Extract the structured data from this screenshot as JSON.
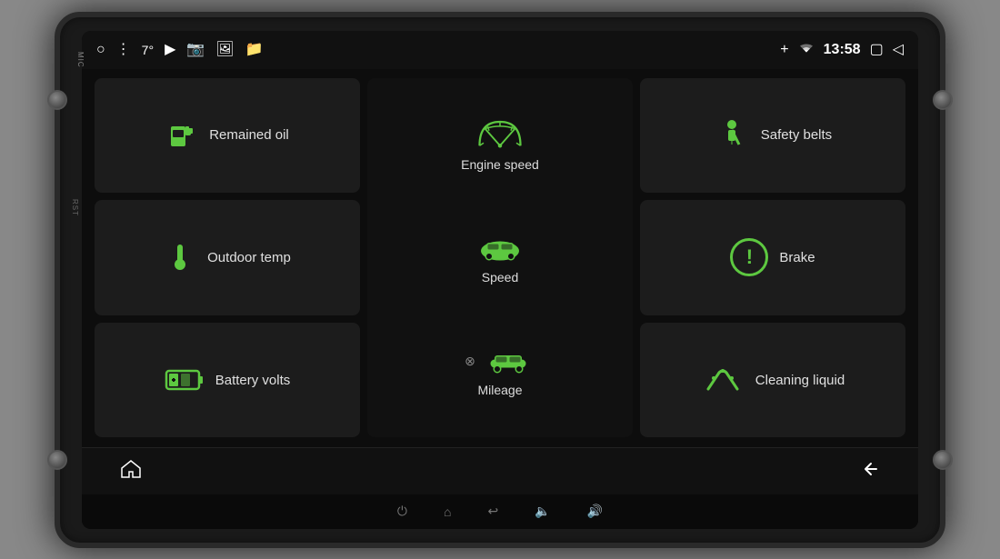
{
  "device": {
    "micLabel": "MIC",
    "rstLabel": "RST"
  },
  "statusBar": {
    "temperature": "7°",
    "time": "13:58",
    "bluetoothIcon": "bluetooth",
    "wifiIcon": "wifi"
  },
  "tiles": {
    "remainedOil": "Remained oil",
    "outdoorTemp": "Outdoor temp",
    "batteryVolts": "Battery volts",
    "engineSpeed": "Engine speed",
    "speed": "Speed",
    "mileage": "Mileage",
    "safetyBelts": "Safety belts",
    "brake": "Brake",
    "cleaningLiquid": "Cleaning liquid"
  },
  "bottomNav": {
    "homeLabel": "⌂",
    "backLabel": "↩"
  },
  "systemBar": {
    "powerIcon": "⏻",
    "homeIcon": "⌂",
    "backIcon": "↩",
    "volDownIcon": "🔈",
    "volUpIcon": "🔊"
  }
}
